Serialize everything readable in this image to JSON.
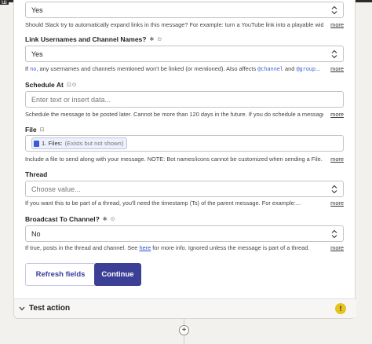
{
  "window": {
    "corner_label": "ɯ"
  },
  "fields": [
    {
      "id": "expand",
      "label": "",
      "value": "Yes",
      "description": "Should Slack try to automatically expand links in this message? For example: turn a YouTube link into a playable widget.",
      "more": "more"
    },
    {
      "id": "link_usernames",
      "label": "Link Usernames and Channel Names?",
      "icons": "✱ ⊙",
      "value": "Yes",
      "description_parts": [
        "If ",
        "no",
        ", any usernames and channels mentioned won't be linked (or mentioned). Also affects ",
        "@channel",
        " and ",
        "@group",
        "..."
      ],
      "more": "more"
    },
    {
      "id": "schedule_at",
      "label": "Schedule At",
      "icons": "⊡⊙",
      "placeholder": "Enter text or insert data...",
      "description": "Schedule the message to be posted later. Cannot be more than 120 days in the future. If you do schedule a message,...",
      "more": "more"
    },
    {
      "id": "file",
      "label": "File",
      "icons": "⊡",
      "chip_step": "1. Files:",
      "chip_note": "(Exists but not shown)",
      "description": "Include a file to send along with your message. NOTE: Bot names/icons cannot be customized when sending a File.",
      "more": "more"
    },
    {
      "id": "thread",
      "label": "Thread",
      "placeholder": "Choose value...",
      "description": "If you want this to be part of a thread, you'll need the timestamp (Ts) of the parent message. For example:...",
      "more": "more"
    },
    {
      "id": "broadcast",
      "label": "Broadcast To Channel?",
      "icons": "✱ ⊙",
      "value": "No",
      "description_parts": [
        "If true, posts in the thread and channel. See ",
        "here",
        " for more info. Ignored unless the message is part of a thread."
      ],
      "more": "more"
    }
  ],
  "buttons": {
    "refresh": "Refresh fields",
    "continue": "Continue"
  },
  "test_section": {
    "label": "Test action",
    "warning_glyph": "!"
  },
  "add_step": "+",
  "colors": {
    "primary": "#3b3f96",
    "warning": "#e7c320",
    "link": "#2952cc"
  }
}
